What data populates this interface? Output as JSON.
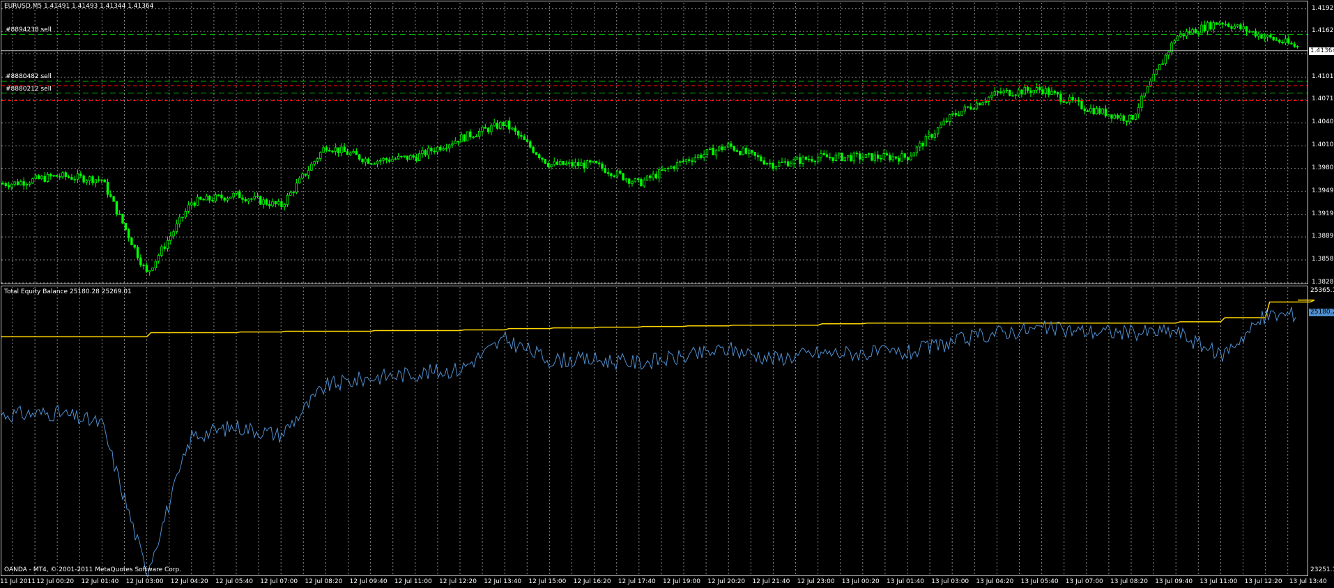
{
  "main_chart": {
    "header": "EURUSD,M5  1.41491 1.41493 1.41344 1.41364",
    "price_ticks": [
      "1.41920",
      "1.41620",
      "1.41325",
      "1.41010",
      "1.40710",
      "1.40405",
      "1.40100",
      "1.39800",
      "1.39495",
      "1.39190",
      "1.38890",
      "1.38585",
      "1.38280"
    ],
    "price_tick_values": [
      1.4192,
      1.4162,
      1.41325,
      1.4101,
      1.4071,
      1.40405,
      1.401,
      1.398,
      1.39495,
      1.3919,
      1.3889,
      1.38585,
      1.3828
    ],
    "current_price_tag": "1.41364",
    "current_price": 1.41364,
    "order_lines": [
      {
        "label": "#8894238 sell",
        "price": 1.4158
      },
      {
        "label": "#8880482 sell",
        "price": 1.4096
      },
      {
        "label": "#8880212 sell",
        "price": 1.408
      }
    ],
    "stop_lines": [
      1.409,
      1.407
    ],
    "candle_color": "#00ff00",
    "order_line_color": "#00c000",
    "stop_line_color": "#ff0000"
  },
  "indicator_panel": {
    "header": "Total Equity Balance 25180.28 25269.01",
    "top_tick": "25365.1",
    "bottom_tick": "23251.1",
    "equity_tag": "25180.2",
    "balance_color": "#ffd700",
    "equity_color": "#4f8fd0"
  },
  "time_axis": [
    "11 Jul 2011",
    "12 Jul 00:20",
    "12 Jul 01:40",
    "12 Jul 03:00",
    "12 Jul 04:20",
    "12 Jul 05:40",
    "12 Jul 07:00",
    "12 Jul 08:20",
    "12 Jul 09:40",
    "12 Jul 11:00",
    "12 Jul 12:20",
    "12 Jul 13:40",
    "12 Jul 15:00",
    "12 Jul 16:20",
    "12 Jul 17:40",
    "12 Jul 19:00",
    "12 Jul 20:20",
    "12 Jul 21:40",
    "12 Jul 23:00",
    "13 Jul 00:20",
    "13 Jul 01:40",
    "13 Jul 03:00",
    "13 Jul 04:20",
    "13 Jul 05:40",
    "13 Jul 07:00",
    "13 Jul 08:20",
    "13 Jul 09:40",
    "13 Jul 11:00",
    "13 Jul 12:20",
    "13 Jul 13:40"
  ],
  "copyright": "OANDA - MT4, © 2001-2011 MetaQuotes Software Corp.",
  "chart_data": [
    {
      "type": "line",
      "title": "EURUSD,M5",
      "xlabel": "",
      "ylabel": "",
      "ylim": [
        1.3828,
        1.42
      ],
      "x": [
        "11 Jul 2011",
        "12 Jul 00:20",
        "12 Jul 01:40",
        "12 Jul 03:00",
        "12 Jul 04:20",
        "12 Jul 05:40",
        "12 Jul 07:00",
        "12 Jul 08:20",
        "12 Jul 09:40",
        "12 Jul 11:00",
        "12 Jul 12:20",
        "12 Jul 13:40",
        "12 Jul 15:00",
        "12 Jul 16:20",
        "12 Jul 17:40",
        "12 Jul 19:00",
        "12 Jul 20:20",
        "12 Jul 21:40",
        "12 Jul 23:00",
        "13 Jul 00:20",
        "13 Jul 01:40",
        "13 Jul 03:00",
        "13 Jul 04:20",
        "13 Jul 05:40",
        "13 Jul 07:00",
        "13 Jul 08:20",
        "13 Jul 09:40",
        "13 Jul 11:00",
        "13 Jul 12:20",
        "13 Jul 13:40"
      ],
      "series": [
        {
          "name": "",
          "values": [
            1.396,
            1.397,
            1.3965,
            1.384,
            1.3935,
            1.3945,
            1.393,
            1.401,
            1.399,
            1.3995,
            1.402,
            1.404,
            1.3985,
            1.3985,
            1.396,
            1.399,
            1.401,
            1.3985,
            1.3995,
            1.3995,
            1.3995,
            1.405,
            1.408,
            1.4085,
            1.406,
            1.4045,
            1.4155,
            1.4175,
            1.4155,
            1.41364
          ]
        }
      ]
    },
    {
      "type": "line",
      "title": "Total Equity Balance",
      "xlabel": "",
      "ylabel": "",
      "ylim": [
        23251.1,
        25365.1
      ],
      "x": [
        "11 Jul 2011",
        "12 Jul 00:20",
        "12 Jul 01:40",
        "12 Jul 03:00",
        "12 Jul 04:20",
        "12 Jul 05:40",
        "12 Jul 07:00",
        "12 Jul 08:20",
        "12 Jul 09:40",
        "12 Jul 11:00",
        "12 Jul 12:20",
        "12 Jul 13:40",
        "12 Jul 15:00",
        "12 Jul 16:20",
        "12 Jul 17:40",
        "12 Jul 19:00",
        "12 Jul 20:20",
        "12 Jul 21:40",
        "12 Jul 23:00",
        "13 Jul 00:20",
        "13 Jul 01:40",
        "13 Jul 03:00",
        "13 Jul 04:20",
        "13 Jul 05:40",
        "13 Jul 07:00",
        "13 Jul 08:20",
        "13 Jul 09:40",
        "13 Jul 11:00",
        "13 Jul 12:20",
        "13 Jul 13:40"
      ],
      "series": [
        {
          "name": "",
          "values": [
            25000,
            25000,
            25000,
            25030,
            25030,
            25035,
            25040,
            25040,
            25045,
            25045,
            25050,
            25060,
            25065,
            25070,
            25075,
            25080,
            25085,
            25085,
            25095,
            25100,
            25100,
            25100,
            25100,
            25100,
            25100,
            25100,
            25110,
            25140,
            25255,
            25269.01
          ]
        },
        {
          "name": "",
          "values": [
            24430,
            24440,
            24360,
            23270,
            24270,
            24340,
            24280,
            24640,
            24700,
            24730,
            24760,
            24980,
            24830,
            24830,
            24810,
            24850,
            24910,
            24840,
            24880,
            24880,
            24880,
            24960,
            25030,
            25060,
            25040,
            25030,
            25040,
            24860,
            25150,
            25180.28
          ]
        }
      ]
    }
  ]
}
